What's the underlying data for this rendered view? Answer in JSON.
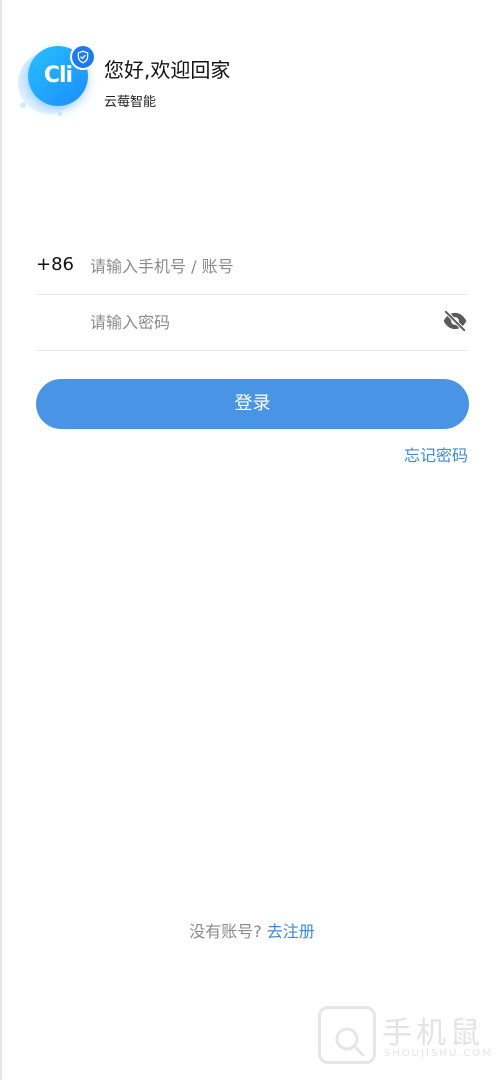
{
  "header": {
    "logo_text": "Cli",
    "greeting": "您好,欢迎回家",
    "app_name": "云莓智能"
  },
  "form": {
    "country_code": "+86",
    "account_placeholder": "请输入手机号 / 账号",
    "password_placeholder": "请输入密码",
    "login_label": "登录",
    "forgot_label": "忘记密码"
  },
  "footer": {
    "no_account_text": "没有账号?",
    "register_label": "去注册"
  },
  "watermark": {
    "text": "手机鼠",
    "sub": "SHOUJISHU.COM"
  },
  "colors": {
    "primary": "#4a94e6",
    "link": "#3d8bd6",
    "placeholder": "#8a8a8a",
    "divider": "#e8e8e8"
  },
  "icons": {
    "password_toggle": "eye-off-icon",
    "logo_badge": "shield-check-icon"
  }
}
